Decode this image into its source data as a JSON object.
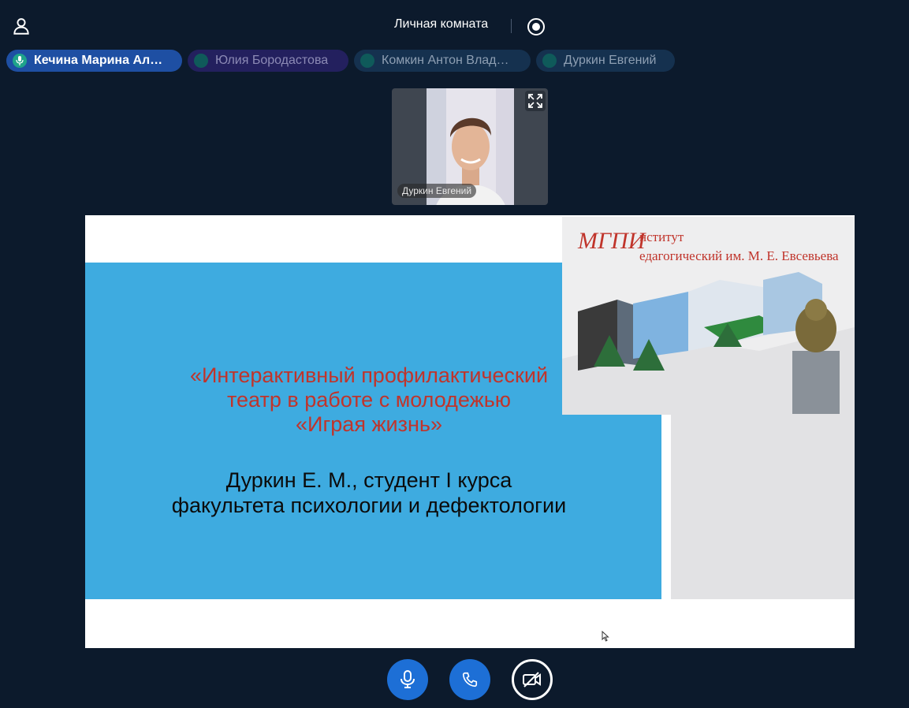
{
  "header": {
    "room_title": "Личная комната",
    "icons": {
      "user": "user-icon",
      "record": "record-icon"
    }
  },
  "participants": [
    {
      "name": "Кечина Марина Ал…",
      "speaking": true,
      "color": "#1e4fa3"
    },
    {
      "name": "Юлия Бородастова",
      "speaking": false,
      "color": "#23205e"
    },
    {
      "name": "Комкин Антон Влад…",
      "speaking": false,
      "color": "#15314f"
    },
    {
      "name": "Дуркин Евгений",
      "speaking": false,
      "color": "#15314f"
    }
  ],
  "video": {
    "name": "Дуркин Евгений",
    "icons": {
      "expand": "expand-icon"
    }
  },
  "slide": {
    "title_lines": [
      "«Интерактивный профилактический",
      "театр в работе с молодежью",
      "«Играя жизнь»"
    ],
    "subtitle_lines": [
      "Дуркин Е. М., студент I курса",
      "факультета психологии и дефектологии"
    ],
    "logo": {
      "mark": "МГПИ",
      "institute": "нститут",
      "full_name": "едагогический им. М. Е. Евсевьева"
    },
    "colors": {
      "background": "#3eabe0",
      "title": "#c0342b"
    }
  },
  "controls": {
    "icons": {
      "mic": "microphone-icon",
      "call": "phone-icon",
      "camera": "camera-off-icon"
    },
    "colors": {
      "active": "#1d6fd6"
    }
  }
}
